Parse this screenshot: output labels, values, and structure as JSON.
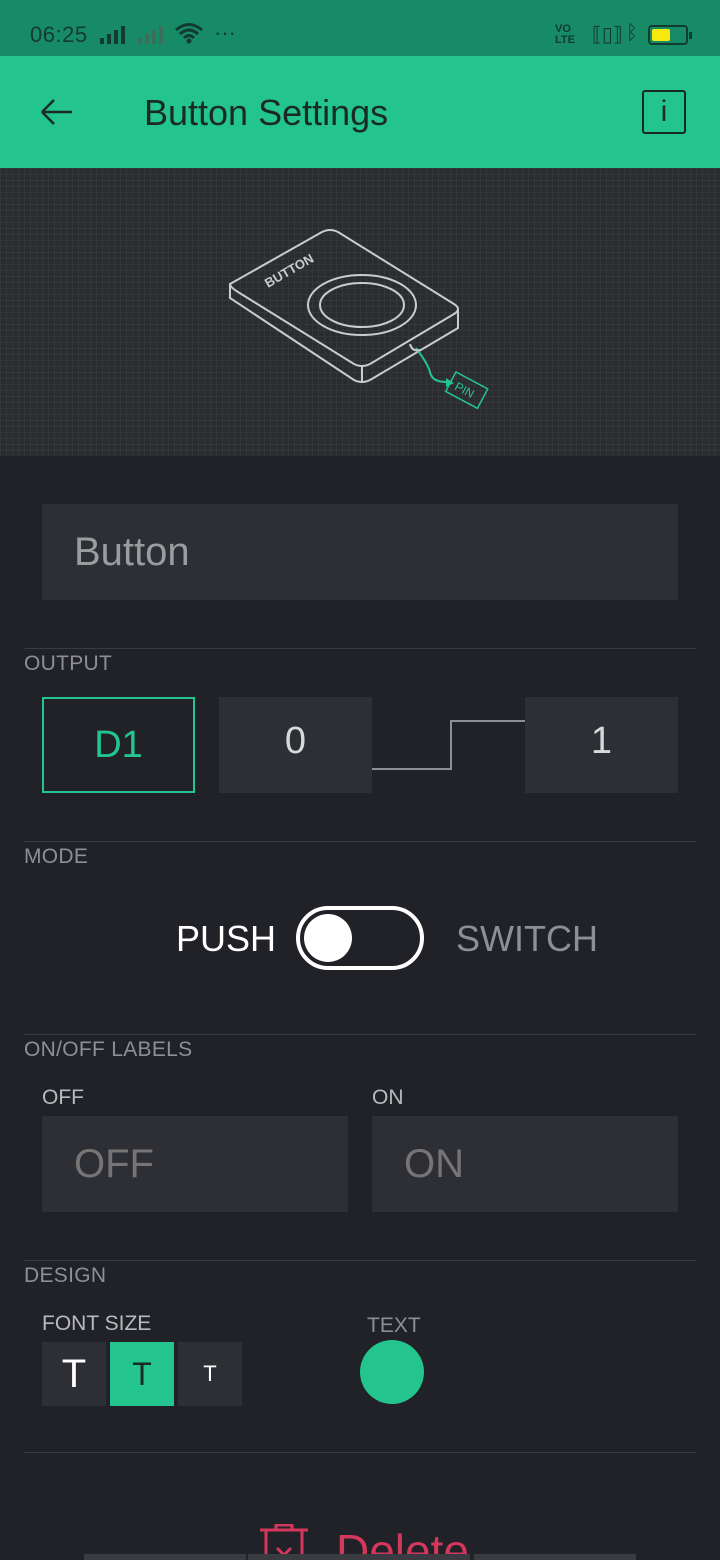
{
  "status_bar": {
    "time": "06:25",
    "more": "···",
    "volte": "VO LTE",
    "battery_color": "#f7e80e"
  },
  "app_bar": {
    "title": "Button Settings",
    "back_icon": "arrow-left-icon",
    "info_label": "i"
  },
  "hero": {
    "widget_label": "BUTTON",
    "pin_label": "PIN"
  },
  "name_field": {
    "value": "",
    "placeholder": "Button"
  },
  "output": {
    "section_label": "OUTPUT",
    "pin": "D1",
    "low_value": "0",
    "high_value": "1"
  },
  "mode": {
    "section_label": "MODE",
    "push_label": "PUSH",
    "switch_label": "SWITCH",
    "selected": "PUSH"
  },
  "labels": {
    "section_label": "ON/OFF LABELS",
    "off_caption": "OFF",
    "on_caption": "ON",
    "off_placeholder": "OFF",
    "on_placeholder": "ON"
  },
  "design": {
    "section_label": "DESIGN",
    "font_size_label": "FONT SIZE",
    "font_sizes": [
      "T",
      "T",
      "T"
    ],
    "selected_font_size_index": 1,
    "text_color_label": "TEXT",
    "text_color": "#23c48e"
  },
  "delete": {
    "label": "Delete",
    "icon": "trash-icon"
  },
  "colors": {
    "accent": "#23c48e",
    "danger": "#d4375c",
    "background": "#212227"
  }
}
